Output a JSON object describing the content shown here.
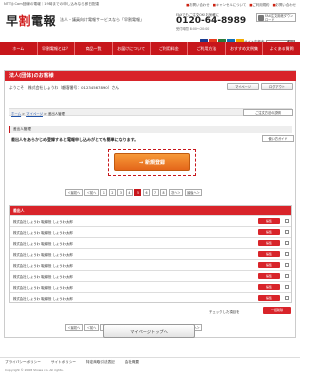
{
  "topbar": {
    "tagline": "NTT/J:Com回線の電報｜19時までの申し込みなら即日配達",
    "links": [
      "お問い合わせ",
      "キャンセルについて",
      "ご利用規約",
      "お問い合わせ"
    ],
    "mark": "■"
  },
  "header": {
    "logo_a": "早",
    "logo_b": "割",
    "logo_c": "電報",
    "sub": "法人・議員向け電報サービスなら「早割電報」",
    "freedial_label": "FAXでもご注文OK!お気軽に",
    "freedial_number": "0120-64-8989",
    "hours": "受付時間 8:00〜20:00",
    "fax_label": "FAX注文用紙ダウンロード",
    "site_search_label": "サイト内検索",
    "site_search_go": "検索",
    "card_colors": [
      "#1a3c8f",
      "#e63a1e",
      "#2a7a3a",
      "#0e6fb4",
      "#f2a900"
    ]
  },
  "nav": {
    "items": [
      "ホーム",
      "早割電報とは？",
      "商品一覧",
      "お届けについて",
      "ご利用料金",
      "ご利用方法",
      "おすすめ文例集",
      "よくある質問"
    ]
  },
  "panel": {
    "title": "法人(団体)のお客様",
    "welcome": "ようこそ　株式会社しょうわ（顧客番号：01234567890）さん",
    "mypage": "マイページ",
    "logout": "ログアウト",
    "breadcrumb_home": "ホーム",
    "breadcrumb_mypage": "マイページ",
    "breadcrumb_current": "差出人管理",
    "breadcrumb_sep": " > ",
    "howto": "ご注文方法の説明",
    "section_title": "差出人管理",
    "description": "差出人をあらかじめ登録すると電報申し込みがとても簡単になります。",
    "use_guide": "使い方ガイド",
    "new_register": "→ 新規登録"
  },
  "pager": {
    "first": "＜最初へ",
    "prev": "＜前へ",
    "pages": [
      "1",
      "2",
      "3",
      "4",
      "5",
      "6",
      "7",
      "8"
    ],
    "active_index": 4,
    "next": "次へ＞",
    "last": "最後へ＞"
  },
  "list": {
    "header": "差出人",
    "rows": [
      "株式会社しょうわ 取締役 しょうわ太郎",
      "株式会社しょうわ 取締役 しょうわ太郎",
      "株式会社しょうわ 取締役 しょうわ太郎",
      "株式会社しょうわ 取締役 しょうわ太郎",
      "株式会社しょうわ 取締役 しょうわ太郎",
      "株式会社しょうわ 取締役 しょうわ太郎",
      "株式会社しょうわ 取締役 しょうわ太郎",
      "株式会社しょうわ 取締役 しょうわ太郎"
    ],
    "edit_label": "編集",
    "bulk_note": "チェックした項目を",
    "bulk_delete": "一括削除"
  },
  "top_button": "マイページトップへ",
  "footer": {
    "links": [
      "プライバシーポリシー",
      "サイトポリシー",
      "特定商取引法表記",
      "会社概要"
    ],
    "copyright": "Copyright © 2008 Showa co. All rights."
  }
}
